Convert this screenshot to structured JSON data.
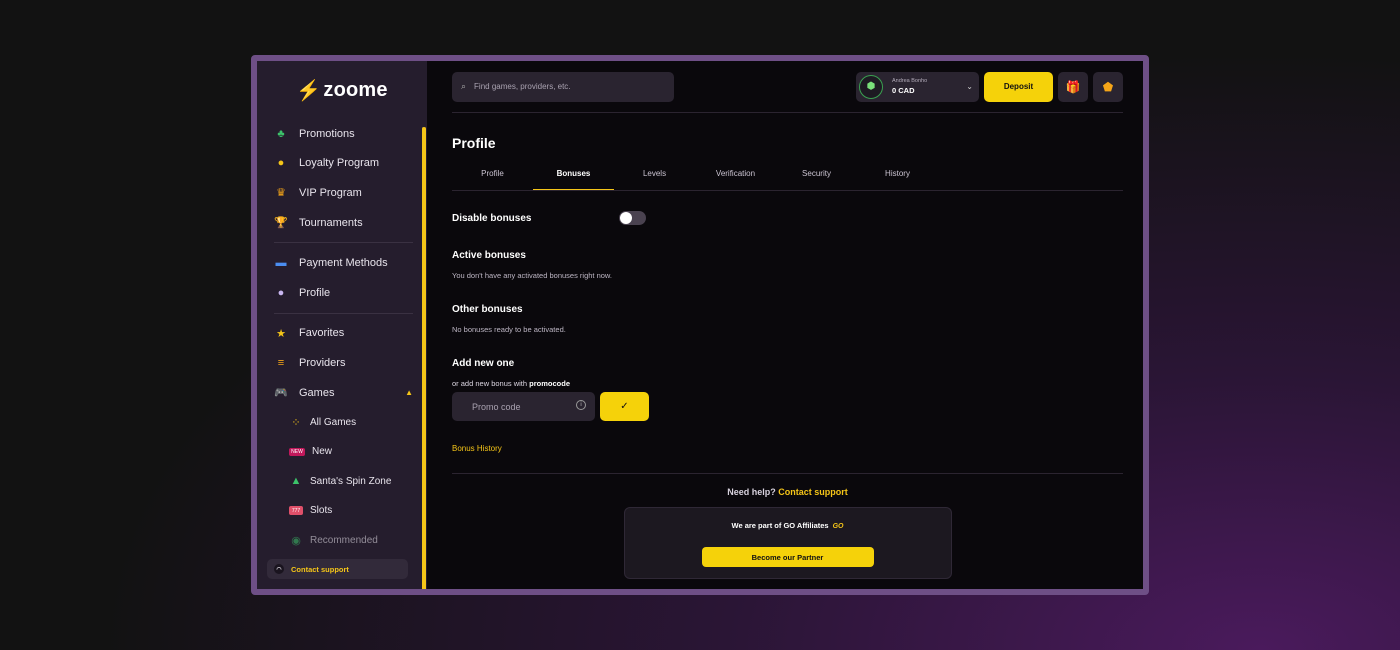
{
  "sidebar": {
    "logo": "zoome",
    "items": [
      {
        "label": "Promotions",
        "icon": "clover-icon"
      },
      {
        "label": "Loyalty Program",
        "icon": "gold-coin-icon"
      },
      {
        "label": "VIP Program",
        "icon": "crown-icon"
      },
      {
        "label": "Tournaments",
        "icon": "trophy-icon"
      },
      {
        "label": "Payment Methods",
        "icon": "credit-card-icon"
      },
      {
        "label": "Profile",
        "icon": "user-icon"
      },
      {
        "label": "Favorites",
        "icon": "star-icon"
      },
      {
        "label": "Providers",
        "icon": "providers-icon"
      },
      {
        "label": "Games",
        "icon": "gamepad-icon"
      }
    ],
    "games_sub": [
      {
        "label": "All Games",
        "icon": "grid-icon"
      },
      {
        "label": "New",
        "icon": "new-badge-icon"
      },
      {
        "label": "Santa's Spin Zone",
        "icon": "christmas-tree-icon"
      },
      {
        "label": "Slots",
        "icon": "slot-machine-icon"
      },
      {
        "label": "Recommended",
        "icon": "recommended-icon"
      }
    ],
    "contact": "Contact support"
  },
  "topbar": {
    "search_placeholder": "Find games, providers, etc.",
    "account_name": "Andrea Bonho",
    "balance": "0 CAD",
    "deposit": "Deposit"
  },
  "profile": {
    "title": "Profile",
    "tabs": [
      "Profile",
      "Bonuses",
      "Levels",
      "Verification",
      "Security",
      "History"
    ],
    "active_tab": "Bonuses",
    "disable_bonuses": "Disable bonuses",
    "disable_bonuses_on": false,
    "active_bonuses_title": "Active bonuses",
    "active_bonuses_text": "You don't have any activated bonuses right now.",
    "other_bonuses_title": "Other bonuses",
    "other_bonuses_text": "No bonuses ready to be activated.",
    "add_new_title": "Add new one",
    "promo_hint_prefix": "or add new bonus with",
    "promo_hint_bold": "promocode",
    "promo_placeholder": "Promo code",
    "bonus_history": "Bonus History",
    "help_text": "Need help?",
    "help_link": "Contact support",
    "partner_text": "We are part of GO Affiliates",
    "partner_badge": "GO",
    "partner_button": "Become our Partner"
  },
  "colors": {
    "accent": "#f5d20a",
    "frame": "#6e4f86",
    "sidebar": "#251d2d"
  }
}
